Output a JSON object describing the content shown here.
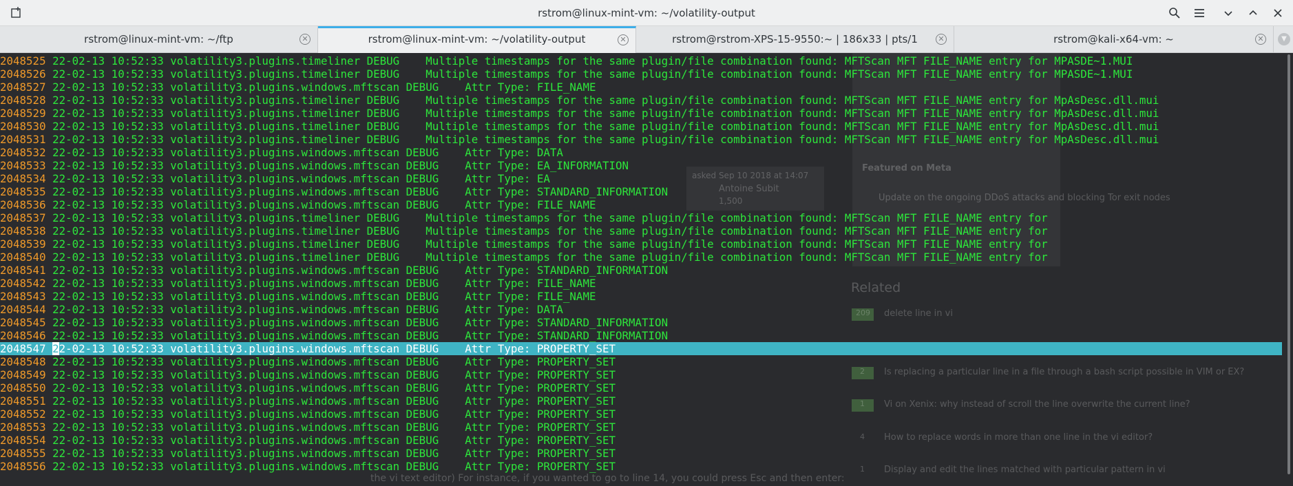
{
  "window": {
    "title": "rstrom@linux-mint-vm: ~/volatility-output",
    "icons": [
      "new-tab-icon",
      "search-icon",
      "hamburger-menu-icon",
      "minimize-icon",
      "maximize-icon"
    ]
  },
  "tabs": [
    {
      "label": "rstrom@linux-mint-vm: ~/ftp",
      "active": false
    },
    {
      "label": "rstrom@linux-mint-vm: ~/volatility-output",
      "active": true
    },
    {
      "label": "rstrom@rstrom-XPS-15-9550:~ | 186x33 | pts/1",
      "active": false
    },
    {
      "label": "rstrom@kali-x64-vm: ~",
      "active": false
    }
  ],
  "terminal": {
    "highlight_color": "#3fb4c4",
    "text_color": "#2de63b",
    "line_number_color": "#f09a2a",
    "lines": [
      {
        "n": "2048525",
        "text": " 22-02-13 10:52:33 volatility3.plugins.timeliner DEBUG    Multiple timestamps for the same plugin/file combination found: MFTScan MFT FILE_NAME entry for MPASDE~1.MUI"
      },
      {
        "n": "2048526",
        "text": " 22-02-13 10:52:33 volatility3.plugins.timeliner DEBUG    Multiple timestamps for the same plugin/file combination found: MFTScan MFT FILE_NAME entry for MPASDE~1.MUI"
      },
      {
        "n": "2048527",
        "text": " 22-02-13 10:52:33 volatility3.plugins.windows.mftscan DEBUG    Attr Type: FILE_NAME"
      },
      {
        "n": "2048528",
        "text": " 22-02-13 10:52:33 volatility3.plugins.timeliner DEBUG    Multiple timestamps for the same plugin/file combination found: MFTScan MFT FILE_NAME entry for MpAsDesc.dll.mui"
      },
      {
        "n": "2048529",
        "text": " 22-02-13 10:52:33 volatility3.plugins.timeliner DEBUG    Multiple timestamps for the same plugin/file combination found: MFTScan MFT FILE_NAME entry for MpAsDesc.dll.mui"
      },
      {
        "n": "2048530",
        "text": " 22-02-13 10:52:33 volatility3.plugins.timeliner DEBUG    Multiple timestamps for the same plugin/file combination found: MFTScan MFT FILE_NAME entry for MpAsDesc.dll.mui"
      },
      {
        "n": "2048531",
        "text": " 22-02-13 10:52:33 volatility3.plugins.timeliner DEBUG    Multiple timestamps for the same plugin/file combination found: MFTScan MFT FILE_NAME entry for MpAsDesc.dll.mui"
      },
      {
        "n": "2048532",
        "text": " 22-02-13 10:52:33 volatility3.plugins.windows.mftscan DEBUG    Attr Type: DATA"
      },
      {
        "n": "2048533",
        "text": " 22-02-13 10:52:33 volatility3.plugins.windows.mftscan DEBUG    Attr Type: EA_INFORMATION"
      },
      {
        "n": "2048534",
        "text": " 22-02-13 10:52:33 volatility3.plugins.windows.mftscan DEBUG    Attr Type: EA"
      },
      {
        "n": "2048535",
        "text": " 22-02-13 10:52:33 volatility3.plugins.windows.mftscan DEBUG    Attr Type: STANDARD_INFORMATION"
      },
      {
        "n": "2048536",
        "text": " 22-02-13 10:52:33 volatility3.plugins.windows.mftscan DEBUG    Attr Type: FILE_NAME"
      },
      {
        "n": "2048537",
        "text": " 22-02-13 10:52:33 volatility3.plugins.timeliner DEBUG    Multiple timestamps for the same plugin/file combination found: MFTScan MFT FILE_NAME entry for"
      },
      {
        "n": "2048538",
        "text": " 22-02-13 10:52:33 volatility3.plugins.timeliner DEBUG    Multiple timestamps for the same plugin/file combination found: MFTScan MFT FILE_NAME entry for"
      },
      {
        "n": "2048539",
        "text": " 22-02-13 10:52:33 volatility3.plugins.timeliner DEBUG    Multiple timestamps for the same plugin/file combination found: MFTScan MFT FILE_NAME entry for"
      },
      {
        "n": "2048540",
        "text": " 22-02-13 10:52:33 volatility3.plugins.timeliner DEBUG    Multiple timestamps for the same plugin/file combination found: MFTScan MFT FILE_NAME entry for"
      },
      {
        "n": "2048541",
        "text": " 22-02-13 10:52:33 volatility3.plugins.windows.mftscan DEBUG    Attr Type: STANDARD_INFORMATION"
      },
      {
        "n": "2048542",
        "text": " 22-02-13 10:52:33 volatility3.plugins.windows.mftscan DEBUG    Attr Type: FILE_NAME"
      },
      {
        "n": "2048543",
        "text": " 22-02-13 10:52:33 volatility3.plugins.windows.mftscan DEBUG    Attr Type: FILE_NAME"
      },
      {
        "n": "2048544",
        "text": " 22-02-13 10:52:33 volatility3.plugins.windows.mftscan DEBUG    Attr Type: DATA"
      },
      {
        "n": "2048545",
        "text": " 22-02-13 10:52:33 volatility3.plugins.windows.mftscan DEBUG    Attr Type: STANDARD_INFORMATION"
      },
      {
        "n": "2048546",
        "text": " 22-02-13 10:52:33 volatility3.plugins.windows.mftscan DEBUG    Attr Type: STANDARD_INFORMATION"
      },
      {
        "n": "2048547",
        "text": "2-02-13 10:52:33 volatility3.plugins.windows.mftscan DEBUG    Attr Type: PROPERTY_SET",
        "highlight": true,
        "cursor_char": "2"
      },
      {
        "n": "2048548",
        "text": " 22-02-13 10:52:33 volatility3.plugins.windows.mftscan DEBUG    Attr Type: PROPERTY_SET"
      },
      {
        "n": "2048549",
        "text": " 22-02-13 10:52:33 volatility3.plugins.windows.mftscan DEBUG    Attr Type: PROPERTY_SET"
      },
      {
        "n": "2048550",
        "text": " 22-02-13 10:52:33 volatility3.plugins.windows.mftscan DEBUG    Attr Type: PROPERTY_SET"
      },
      {
        "n": "2048551",
        "text": " 22-02-13 10:52:33 volatility3.plugins.windows.mftscan DEBUG    Attr Type: PROPERTY_SET"
      },
      {
        "n": "2048552",
        "text": " 22-02-13 10:52:33 volatility3.plugins.windows.mftscan DEBUG    Attr Type: PROPERTY_SET"
      },
      {
        "n": "2048553",
        "text": " 22-02-13 10:52:33 volatility3.plugins.windows.mftscan DEBUG    Attr Type: PROPERTY_SET"
      },
      {
        "n": "2048554",
        "text": " 22-02-13 10:52:33 volatility3.plugins.windows.mftscan DEBUG    Attr Type: PROPERTY_SET"
      },
      {
        "n": "2048555",
        "text": " 22-02-13 10:52:33 volatility3.plugins.windows.mftscan DEBUG    Attr Type: PROPERTY_SET"
      },
      {
        "n": "2048556",
        "text": " 22-02-13 10:52:33 volatility3.plugins.windows.mftscan DEBUG    Attr Type: PROPERTY_SET"
      }
    ]
  },
  "background_page": {
    "asked": "asked Sep 10 2018 at 14:07",
    "user": "Antoine Subit",
    "reputation": "1,500",
    "featured_heading": "Featured on Meta",
    "featured_item": "Update on the ongoing DDoS attacks and blocking Tor exit nodes",
    "related_heading": "Related",
    "related": [
      {
        "count": "209",
        "text": "delete line in vi"
      },
      {
        "count": "2",
        "text": "Is replacing a particular line in a file through a bash script possible in VIM or EX?"
      },
      {
        "count": "1",
        "text": "Vi on Xenix: why instead of scroll the line overwrite the current line?"
      },
      {
        "count": "4",
        "text": "How to replace words in more than one line in the vi editor?"
      },
      {
        "count": "1",
        "text": "Display and edit the lines matched with particular pattern in vi"
      }
    ],
    "bottom_text": "the vi text editor) For instance, if you wanted to go to line 14, you could press Esc and then enter:"
  }
}
